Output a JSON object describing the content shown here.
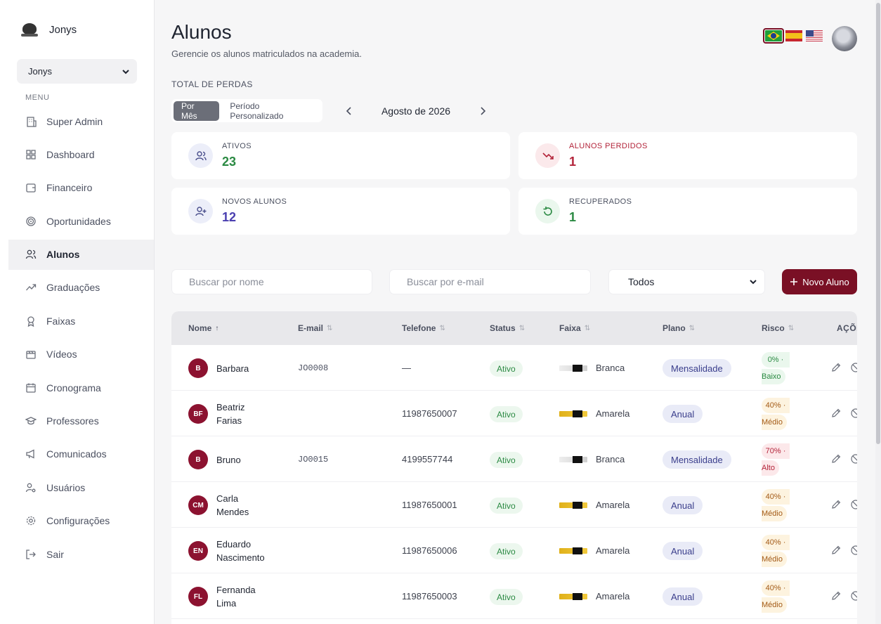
{
  "sidebar": {
    "brand": "Jonys",
    "org_select": "Jonys",
    "menu_label": "MENU",
    "items": [
      {
        "label": "Super Admin",
        "icon": "building-icon"
      },
      {
        "label": "Dashboard",
        "icon": "grid-icon"
      },
      {
        "label": "Financeiro",
        "icon": "wallet-icon"
      },
      {
        "label": "Oportunidades",
        "icon": "target-icon"
      },
      {
        "label": "Alunos",
        "icon": "users-icon",
        "active": true
      },
      {
        "label": "Graduações",
        "icon": "trending-up-icon"
      },
      {
        "label": "Faixas",
        "icon": "award-icon"
      },
      {
        "label": "Vídeos",
        "icon": "video-icon"
      },
      {
        "label": "Cronograma",
        "icon": "calendar-icon"
      },
      {
        "label": "Professores",
        "icon": "graduation-cap-icon"
      },
      {
        "label": "Comunicados",
        "icon": "megaphone-icon"
      },
      {
        "label": "Usuários",
        "icon": "user-cog-icon"
      },
      {
        "label": "Configurações",
        "icon": "gear-icon"
      },
      {
        "label": "Sair",
        "icon": "logout-icon"
      }
    ]
  },
  "header": {
    "title": "Alunos",
    "subtitle": "Gerencie os alunos matriculados na academia.",
    "languages": [
      "pt-BR",
      "es",
      "en-US"
    ]
  },
  "losses": {
    "label": "TOTAL DE PERDAS",
    "toggle": [
      "Por Mês",
      "Período Personalizado"
    ],
    "month": "Agosto de 2026"
  },
  "cards": {
    "ativos": {
      "label": "ATIVOS",
      "value": "23",
      "color": "#2b8a43"
    },
    "perdidos": {
      "label": "ALUNOS PERDIDOS",
      "value": "1",
      "color": "#b3243a"
    },
    "novos": {
      "label": "NOVOS ALUNOS",
      "value": "12",
      "color": "#4a3fb0"
    },
    "recuperados": {
      "label": "RECUPERADOS",
      "value": "1",
      "color": "#2b8a43"
    }
  },
  "filters": {
    "name_placeholder": "Buscar por nome",
    "email_placeholder": "Buscar por e-mail",
    "status_selected": "Todos",
    "new_button": "Novo Aluno"
  },
  "table": {
    "headers": [
      "Nome",
      "E-mail",
      "Telefone",
      "Status",
      "Faixa",
      "Plano",
      "Risco",
      "AÇÕES"
    ],
    "rows": [
      {
        "initials": "B",
        "name_lines": [
          "Barbara"
        ],
        "email": "JO0008",
        "phone": "—",
        "status": "Ativo",
        "belt": "Branca",
        "belt_color": "white",
        "plan": "Mensalidade",
        "risk_pct": "0% ·",
        "risk_level": "Baixo",
        "risk_class": "baixo"
      },
      {
        "initials": "BF",
        "name_lines": [
          "Beatriz",
          "Farias"
        ],
        "email": "",
        "phone": "11987650007",
        "status": "Ativo",
        "belt": "Amarela",
        "belt_color": "yellow",
        "plan": "Anual",
        "risk_pct": "40% ·",
        "risk_level": "Médio",
        "risk_class": "medio"
      },
      {
        "initials": "B",
        "name_lines": [
          "Bruno"
        ],
        "email": "JO0015",
        "phone": "4199557744",
        "status": "Ativo",
        "belt": "Branca",
        "belt_color": "white",
        "plan": "Mensalidade",
        "risk_pct": "70% ·",
        "risk_level": "Alto",
        "risk_class": "alto"
      },
      {
        "initials": "CM",
        "name_lines": [
          "Carla",
          "Mendes"
        ],
        "email": "",
        "phone": "11987650001",
        "status": "Ativo",
        "belt": "Amarela",
        "belt_color": "yellow",
        "plan": "Anual",
        "risk_pct": "40% ·",
        "risk_level": "Médio",
        "risk_class": "medio"
      },
      {
        "initials": "EN",
        "name_lines": [
          "Eduardo",
          "Nascimento"
        ],
        "email": "",
        "phone": "11987650006",
        "status": "Ativo",
        "belt": "Amarela",
        "belt_color": "yellow",
        "plan": "Anual",
        "risk_pct": "40% ·",
        "risk_level": "Médio",
        "risk_class": "medio"
      },
      {
        "initials": "FL",
        "name_lines": [
          "Fernanda",
          "Lima"
        ],
        "email": "",
        "phone": "11987650003",
        "status": "Ativo",
        "belt": "Amarela",
        "belt_color": "yellow",
        "plan": "Anual",
        "risk_pct": "40% ·",
        "risk_level": "Médio",
        "risk_class": "medio"
      }
    ]
  }
}
